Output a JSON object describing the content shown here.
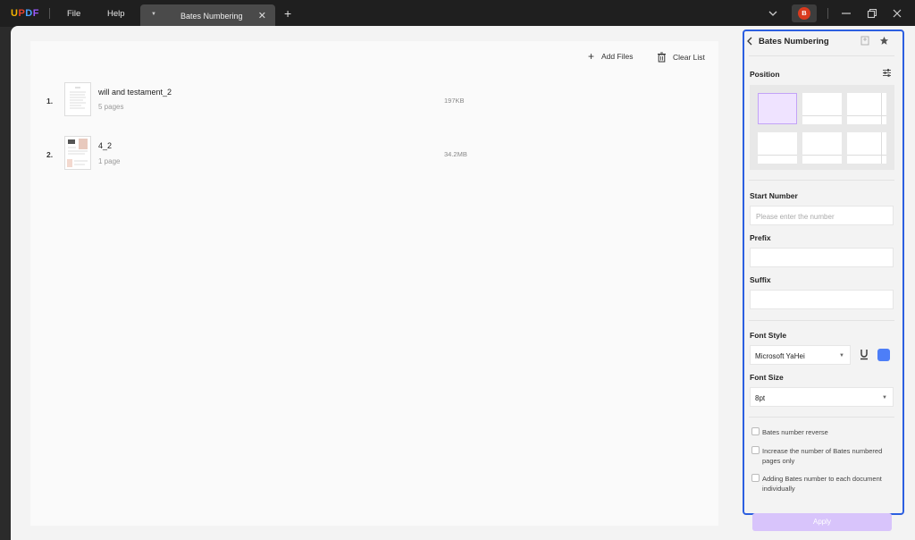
{
  "app": {
    "logo": [
      "U",
      "P",
      "D",
      "F"
    ],
    "logo_colors": [
      "#f7b500",
      "#e8412c",
      "#4aa3ff",
      "#9b59ff"
    ],
    "menu_file": "File",
    "menu_help": "Help",
    "tab_label": "Bates Numbering",
    "avatar_letter": "B",
    "avatar_color": "#d93a1e"
  },
  "toolbar": {
    "add_files": "Add Files",
    "clear_list": "Clear List"
  },
  "files": [
    {
      "num": "1.",
      "name": "will and testament_2",
      "pages": "5 pages",
      "size": "197KB"
    },
    {
      "num": "2.",
      "name": "4_2",
      "pages": "1 page",
      "size": "34.2MB"
    }
  ],
  "panel": {
    "title": "Bates Numbering",
    "position_label": "Position",
    "start_number_label": "Start Number",
    "start_number_placeholder": "Please enter the number",
    "prefix_label": "Prefix",
    "suffix_label": "Suffix",
    "font_style_label": "Font Style",
    "font_name": "Microsoft YaHei",
    "font_color": "#4d7ef7",
    "font_size_label": "Font Size",
    "font_size": "8pt",
    "options": [
      "Bates number reverse",
      "Increase the number of Bates numbered pages only",
      "Adding Bates number to each document individually"
    ],
    "apply": "Apply",
    "accent": "#2c5fe0"
  }
}
